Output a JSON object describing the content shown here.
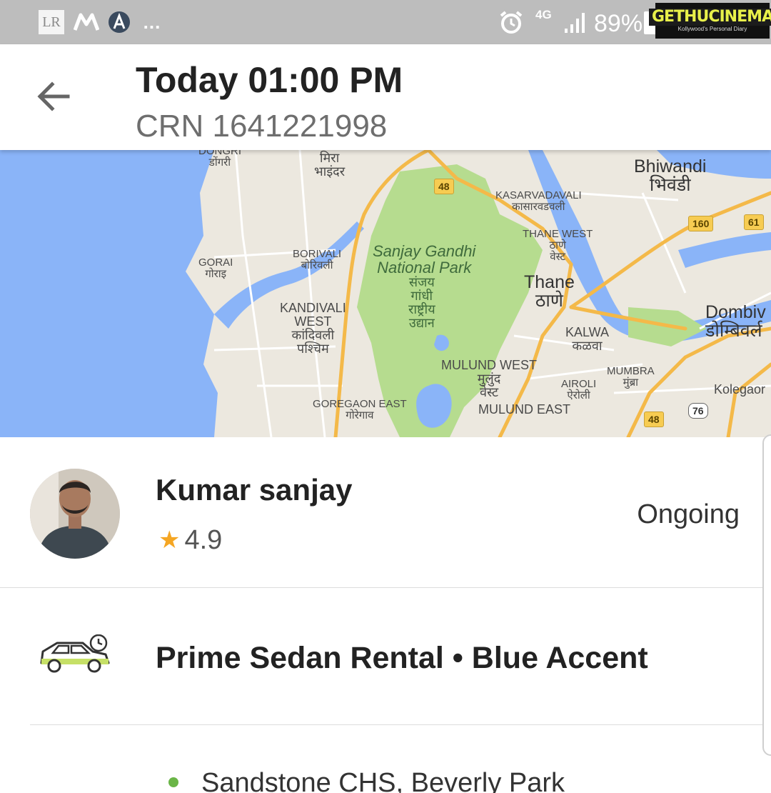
{
  "status_bar": {
    "app_icons": [
      "lr-icon",
      "m-icon",
      "a-icon"
    ],
    "app_lr_label": "LR",
    "overflow": "...",
    "network": "4G",
    "battery": "89%",
    "watermark_title": "GETHUCINEMA",
    "watermark_sub": "Kollywood's Personal Diary"
  },
  "header": {
    "title": "Today 01:00 PM",
    "crn": "CRN 1641221998",
    "back_icon": "arrow-left-icon"
  },
  "map": {
    "labels": {
      "dongri": "DONGRI",
      "dongri_mr": "डोंगरी",
      "mira": "मिरा",
      "bhayandar": "भाइंदर",
      "bhiwandi": "Bhiwandi",
      "bhiwandi_mr": "भिवंडी",
      "kasarvadavali": "KASARVADAVALI",
      "kasarvadavali_mr": "कासारवडवली",
      "thane_west": "THANE WEST",
      "thane_west_mr_1": "ठाणे",
      "thane_west_mr_2": "वेस्ट",
      "gorai": "GORAI",
      "gorai_mr": "गोराइ",
      "borivali": "BORIVALI",
      "borivali_mr": "बोरिवली",
      "park_1": "Sanjay Gandhi",
      "park_2": "National Park",
      "park_mr_1": "संजय",
      "park_mr_2": "गांधी",
      "park_mr_3": "राष्ट्रीय",
      "park_mr_4": "उद्यान",
      "thane": "Thane",
      "thane_mr": "ठाणे",
      "dombivli": "Dombiv",
      "dombivli_mr": "डोम्बिवर्ल",
      "kandivali_1": "KANDIVALI",
      "kandivali_2": "WEST",
      "kandivali_mr_1": "कांदिवली",
      "kandivali_mr_2": "पश्चिम",
      "kalwa": "KALWA",
      "kalwa_mr": "कळवा",
      "mulund_west": "MULUND WEST",
      "mulund_mr_1": "मुलुंद",
      "mulund_mr_2": "वेस्ट",
      "mumbra": "MUMBRA",
      "mumbra_mr": "मुंब्रा",
      "airoli": "AIROLI",
      "airoli_mr": "ऐरोली",
      "kolegaon": "Kolegaor",
      "goregaon_east": "GOREGAON EAST",
      "goregaon_mr": "गोरेगाव",
      "mulund_east": "MULUND EAST"
    },
    "road_badges": {
      "r48_top": "48",
      "r160": "160",
      "r61": "61",
      "r48_bottom": "48",
      "r76": "76"
    },
    "colors": {
      "water": "#8ab4f8",
      "land": "#ece8df",
      "park": "#b6dc8f",
      "highway": "#f4b949"
    }
  },
  "driver": {
    "name": "Kumar sanjay",
    "rating": "4.9",
    "star": "★",
    "status": "Ongoing"
  },
  "ride": {
    "car_icon": "car-clock-icon",
    "label": "Prime Sedan Rental • Blue Accent"
  },
  "pickup": {
    "address": "Sandstone CHS, Beverly Park",
    "dot_color": "#6ab547"
  }
}
